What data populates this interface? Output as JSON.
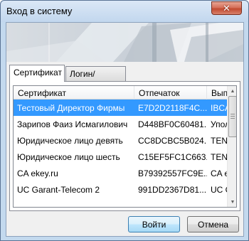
{
  "window": {
    "title": "Вход в систему",
    "close_glyph": "✕"
  },
  "tabs": [
    {
      "label": "Сертификат",
      "active": true
    },
    {
      "label": "Логин/пароль",
      "active": false
    }
  ],
  "certificates": {
    "columns": [
      "Сертификат",
      "Отпечаток",
      "Выпу"
    ],
    "rows": [
      {
        "name": "Тестовый Директор Фирмы",
        "thumbprint": "E7D2D2118F4C...",
        "issuer": "IBCA",
        "selected": true
      },
      {
        "name": "Зарипов Фаиз Исмагилович",
        "thumbprint": "D448BF0C60481...",
        "issuer": "Уполн",
        "selected": false
      },
      {
        "name": "Юридическое лицо девять",
        "thumbprint": "CC8DCBC5B024...",
        "issuer": "TENS",
        "selected": false
      },
      {
        "name": "Юридическое лицо шесть",
        "thumbprint": "C15EF5FC1C663...",
        "issuer": "TENS",
        "selected": false
      },
      {
        "name": "CA ekey.ru",
        "thumbprint": "B79392557FC9E...",
        "issuer": "CA ek",
        "selected": false
      },
      {
        "name": "UC Garant-Telecom 2",
        "thumbprint": "991DD2367D81...",
        "issuer": "UC Ga",
        "selected": false
      }
    ]
  },
  "scrollbar": {
    "up_icon": "▲",
    "down_icon": "▼"
  },
  "buttons": {
    "ok": "Войти",
    "cancel": "Отмена"
  }
}
